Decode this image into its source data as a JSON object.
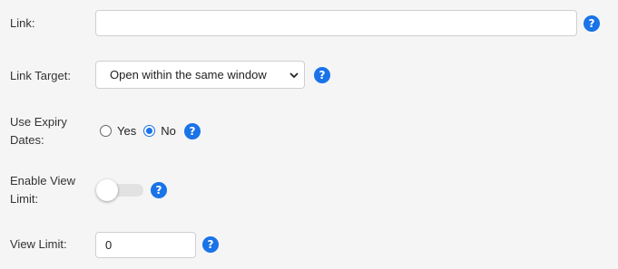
{
  "fields": {
    "link": {
      "label": "Link:",
      "value": "",
      "placeholder": ""
    },
    "link_target": {
      "label": "Link Target:",
      "selected": "Open within the same window"
    },
    "expiry": {
      "label": "Use Expiry Dates:",
      "yes_label": "Yes",
      "no_label": "No",
      "selected": "No"
    },
    "view_limit_toggle": {
      "label": "Enable View Limit:",
      "enabled": false
    },
    "view_limit": {
      "label": "View Limit:",
      "value": "0"
    }
  },
  "help_glyph": "?",
  "icons": {
    "help": "question-circle-icon",
    "dropdown": "chevron-down-icon"
  },
  "colors": {
    "accent": "#1a73e8",
    "background": "#f5f5f5"
  }
}
